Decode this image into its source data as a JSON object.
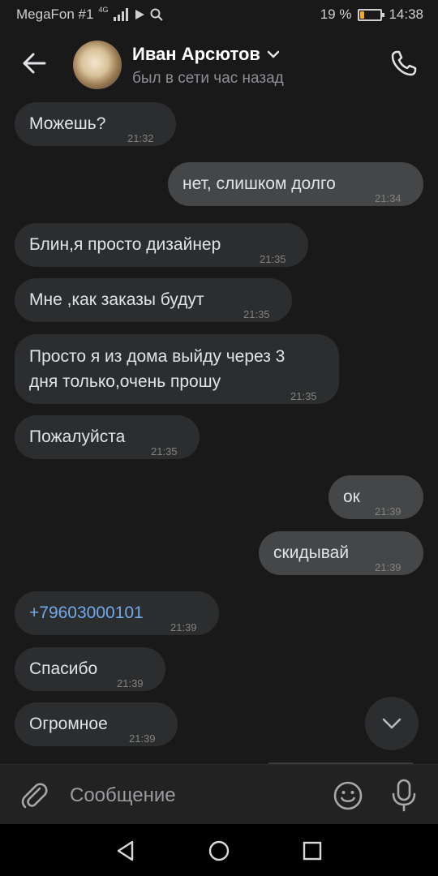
{
  "status_bar": {
    "carrier": "MegaFon #1",
    "network": "4G",
    "battery_percent": "19 %",
    "battery_level": 0.19,
    "time": "14:38"
  },
  "header": {
    "contact_name": "Иван Арсютов",
    "last_seen": "был в сети час назад"
  },
  "messages": [
    {
      "text": "Можешь?",
      "time": "21:32",
      "outgoing": false
    },
    {
      "text": "нет, слишком долго",
      "time": "21:34",
      "outgoing": true
    },
    {
      "text": "Блин,я просто дизайнер",
      "time": "21:35",
      "outgoing": false
    },
    {
      "text": "Мне ,как заказы будут",
      "time": "21:35",
      "outgoing": false
    },
    {
      "text_line1": "Просто я из дома выйду через 3",
      "text_line2": "дня только,очень прошу",
      "time": "21:35",
      "outgoing": false
    },
    {
      "text": "Пожалуйста",
      "time": "21:35",
      "outgoing": false
    },
    {
      "text": "ок",
      "time": "21:39",
      "outgoing": true
    },
    {
      "text": "скидывай",
      "time": "21:39",
      "outgoing": true
    },
    {
      "text": "+79603000101",
      "time": "21:39",
      "outgoing": false,
      "is_phone_link": true
    },
    {
      "text": "Спасибо",
      "time": "21:39",
      "outgoing": false
    },
    {
      "text": "Огромное",
      "time": "21:39",
      "outgoing": false
    }
  ],
  "composer": {
    "placeholder": "Сообщение"
  },
  "colors": {
    "background": "#19191a",
    "incoming_bubble": "#2c2d2e",
    "outgoing_bubble": "#454647",
    "link": "#71aaeb",
    "battery_fill": "#f5a623"
  },
  "icons": [
    "back-arrow-icon",
    "chevron-down-icon",
    "phone-icon",
    "paperclip-icon",
    "emoji-icon",
    "microphone-icon",
    "scroll-down-icon",
    "nav-back-icon",
    "nav-home-icon",
    "nav-recents-icon",
    "play-icon",
    "search-icon",
    "signal-icon"
  ]
}
